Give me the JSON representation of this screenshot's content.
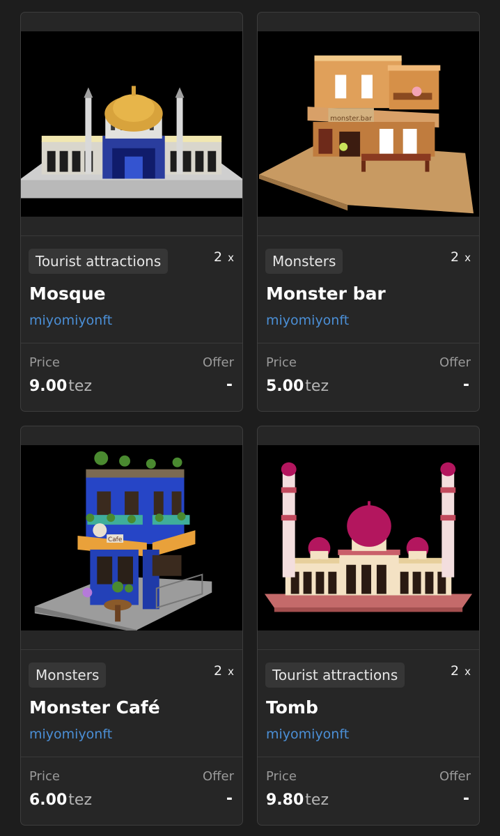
{
  "labels": {
    "price": "Price",
    "offer": "Offer",
    "quantity_suffix": "x",
    "currency": "tez"
  },
  "cards": [
    {
      "category": "Tourist attractions",
      "quantity": "2",
      "title": "Mosque",
      "artist": "miyomiyonft",
      "price": "9.00",
      "offer": "-"
    },
    {
      "category": "Monsters",
      "quantity": "2",
      "title": "Monster bar",
      "artist": "miyomiyonft",
      "price": "5.00",
      "offer": "-"
    },
    {
      "category": "Monsters",
      "quantity": "2",
      "title": "Monster Café",
      "artist": "miyomiyonft",
      "price": "6.00",
      "offer": "-"
    },
    {
      "category": "Tourist attractions",
      "quantity": "2",
      "title": "Tomb",
      "artist": "miyomiyonft",
      "price": "9.80",
      "offer": "-"
    }
  ],
  "sign_texts": {
    "bar_sign": "monster.bar",
    "cafe_sign": "Cafe"
  },
  "colors": {
    "background": "#1d1d1d",
    "card": "#262626",
    "artist_link": "#4b8fd6"
  }
}
